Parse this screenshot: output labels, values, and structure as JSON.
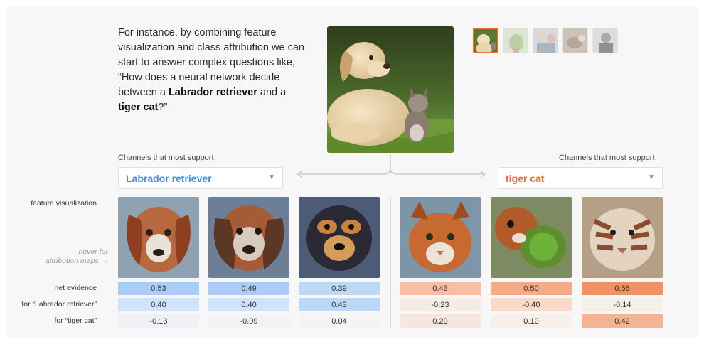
{
  "intro": {
    "line1": "For instance, by combining feature",
    "line2": "visualization and class attribution we can",
    "line3": "start to answer complex questions like,",
    "line4": "“How does a neural network decide",
    "line5_pre": "between a ",
    "line5_bold": "Labrador retriever",
    "line5_post": " and a",
    "line6_bold": "tiger cat",
    "line6_post": "?”"
  },
  "left_panel": {
    "label": "Channels that most support",
    "selected": "Labrador retriever",
    "color": "#3b8fe6"
  },
  "right_panel": {
    "label": "Channels that most support",
    "selected": "tiger cat",
    "color": "#ec6b35"
  },
  "rows": {
    "feature_visualization": "feature visualization",
    "hover_line1": "hover for",
    "hover_line2": "attribution maps →",
    "net_evidence": "net evidence",
    "for_labrador": "for “Labrador retriever”",
    "for_tiger": "for “tiger cat”"
  },
  "channels": [
    {
      "feature": "dog-face-visualization",
      "net": "0.53",
      "lab": "0.40",
      "tiger": "-0.13"
    },
    {
      "feature": "dog-ear-visualization",
      "net": "0.49",
      "lab": "0.40",
      "tiger": "-0.09"
    },
    {
      "feature": "dog-snout-visualization",
      "net": "0.39",
      "lab": "0.43",
      "tiger": "0.04"
    },
    {
      "feature": "cat-face-visualization",
      "net": "0.43",
      "lab": "-0.23",
      "tiger": "0.20"
    },
    {
      "feature": "mixed-animal-visualization",
      "net": "0.50",
      "lab": "-0.40",
      "tiger": "0.10"
    },
    {
      "feature": "tiger-stripes-visualization",
      "net": "0.56",
      "lab": "-0.14",
      "tiger": "0.42"
    }
  ],
  "colors": {
    "accent_orange": "#e8743a",
    "blue_strong": "#a9cdf6",
    "blue_light": "#d6e7fb",
    "orange_strong": "#f3a482",
    "orange_light": "#f9d7c6"
  }
}
